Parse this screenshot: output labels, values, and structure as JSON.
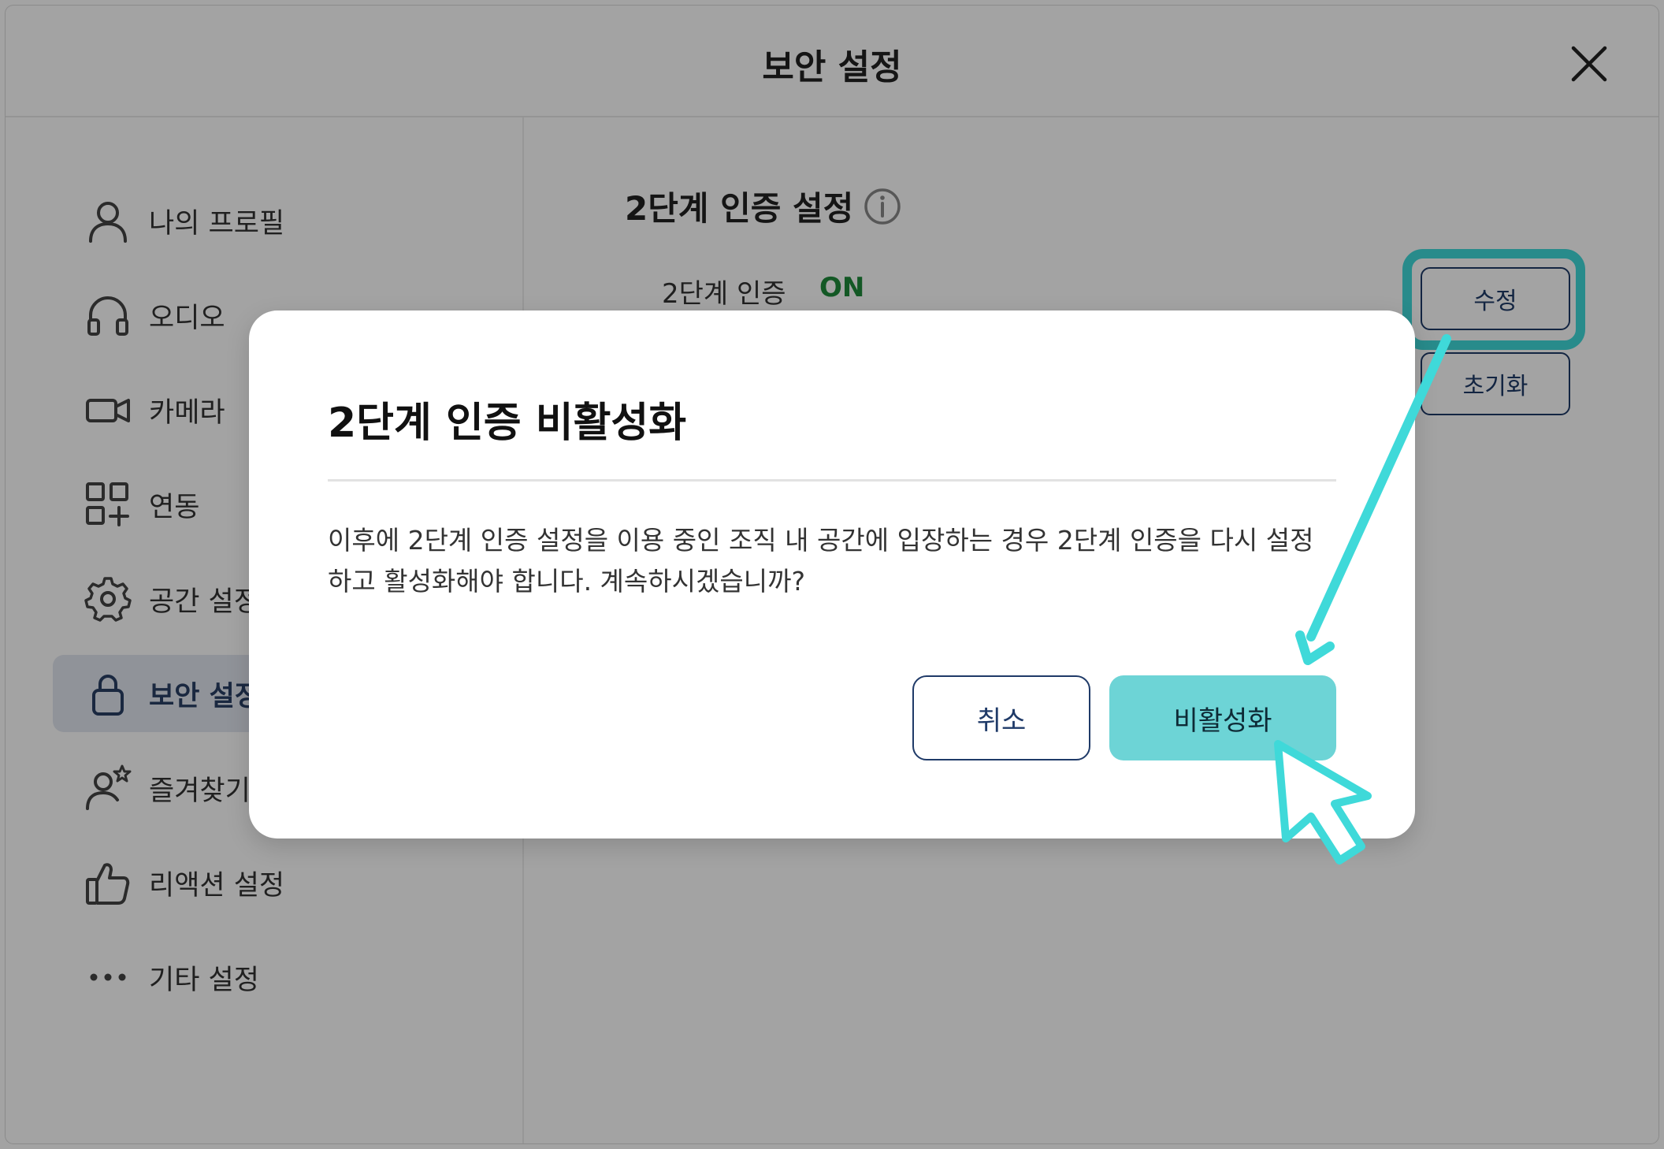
{
  "window": {
    "title": "보안 설정"
  },
  "sidebar": {
    "items": [
      {
        "label": "나의 프로필",
        "icon": "user-icon"
      },
      {
        "label": "오디오",
        "icon": "headphones-icon"
      },
      {
        "label": "카메라",
        "icon": "camera-icon"
      },
      {
        "label": "연동",
        "icon": "apps-add-icon"
      },
      {
        "label": "공간 설정",
        "icon": "gear-icon"
      },
      {
        "label": "보안 설정",
        "icon": "lock-icon",
        "active": true
      },
      {
        "label": "즐겨찾기",
        "icon": "user-star-icon"
      },
      {
        "label": "리액션 설정",
        "icon": "thumbs-up-icon"
      },
      {
        "label": "기타 설정",
        "icon": "more-icon"
      }
    ]
  },
  "main": {
    "section_title": "2단계 인증 설정",
    "row_label": "2단계 인증",
    "row_status": "ON",
    "edit_button": "수정",
    "reset_button": "초기화"
  },
  "dialog": {
    "title": "2단계 인증 비활성화",
    "body": "이후에 2단계 인증 설정을 이용 중인 조직 내 공간에 입장하는 경우 2단계 인증을 다시 설정하고 활성화해야 합니다. 계속하시겠습니까?",
    "cancel_label": "취소",
    "confirm_label": "비활성화"
  },
  "colors": {
    "accent": "#3fd9d9",
    "confirm_button": "#6dd4d6",
    "navy": "#1f3a68",
    "status_on": "#1e8a3b"
  }
}
